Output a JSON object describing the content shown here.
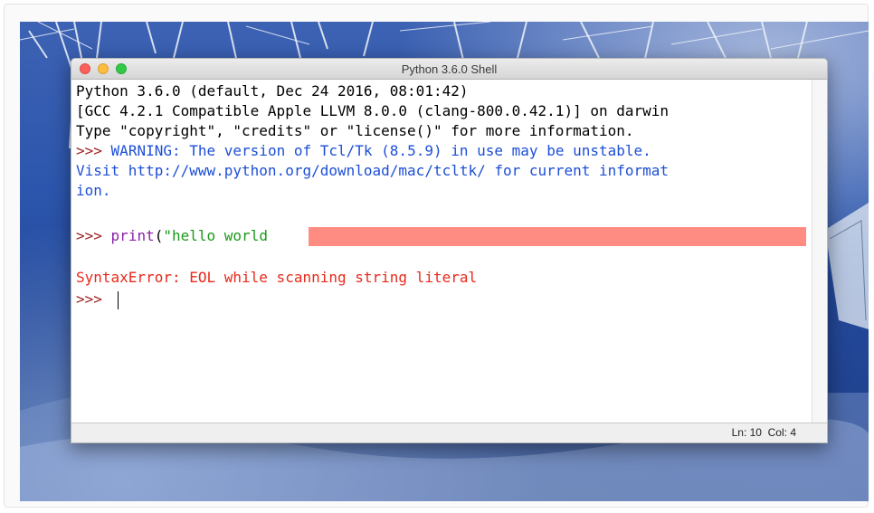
{
  "window": {
    "title": "Python 3.6.0 Shell"
  },
  "shell": {
    "banner_line_1": "Python 3.6.0 (default, Dec 24 2016, 08:01:42)",
    "banner_line_2": "[GCC 4.2.1 Compatible Apple LLVM 8.0.0 (clang-800.0.42.1)] on darwin",
    "banner_line_3": "Type \"copyright\", \"credits\" or \"license()\" for more information.",
    "prompt": ">>>",
    "warning_line_1": "WARNING: The version of Tcl/Tk (8.5.9) in use may be unstable.",
    "warning_line_2": "Visit http://www.python.org/download/mac/tcltk/ for current informat",
    "warning_line_3": "ion.",
    "input_keyword": "print",
    "input_paren": "(",
    "input_string": "\"hello world",
    "error_message": "SyntaxError: EOL while scanning string literal",
    "last_prompt": ">>> "
  },
  "statusbar": {
    "position": "Ln: 10  Col: 4"
  },
  "colors": {
    "prompt": "#a02222",
    "warning": "#1d4fd6",
    "keyword": "#8a22a8",
    "string": "#1a9a1a",
    "error": "#e8291b",
    "error_highlight": "#ff8c82"
  }
}
